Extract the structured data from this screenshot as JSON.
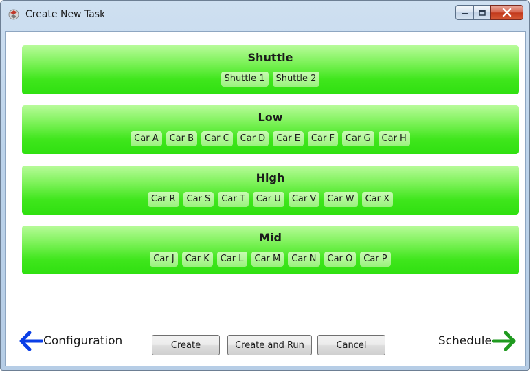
{
  "window": {
    "title": "Create New Task"
  },
  "groups": [
    {
      "title": "Shuttle",
      "items": [
        "Shuttle 1",
        "Shuttle 2"
      ]
    },
    {
      "title": "Low",
      "items": [
        "Car A",
        "Car B",
        "Car C",
        "Car D",
        "Car E",
        "Car F",
        "Car G",
        "Car H"
      ]
    },
    {
      "title": "High",
      "items": [
        "Car R",
        "Car S",
        "Car T",
        "Car U",
        "Car V",
        "Car W",
        "Car X"
      ]
    },
    {
      "title": "Mid",
      "items": [
        "Car J",
        "Car K",
        "Car L",
        "Car M",
        "Car N",
        "Car O",
        "Car P"
      ]
    }
  ],
  "footer": {
    "back_label": "Configuration",
    "next_label": "Schedule",
    "create_label": "Create",
    "create_run_label": "Create and Run",
    "cancel_label": "Cancel"
  },
  "colors": {
    "back_arrow": "#0a3ee6",
    "next_arrow": "#1f9a1f",
    "group_green": "#3fe61c"
  },
  "icons": {
    "app": "app-icon",
    "back": "arrow-left-icon",
    "next": "arrow-right-icon",
    "minimize": "minimize-icon",
    "maximize": "maximize-icon",
    "close": "close-icon"
  }
}
